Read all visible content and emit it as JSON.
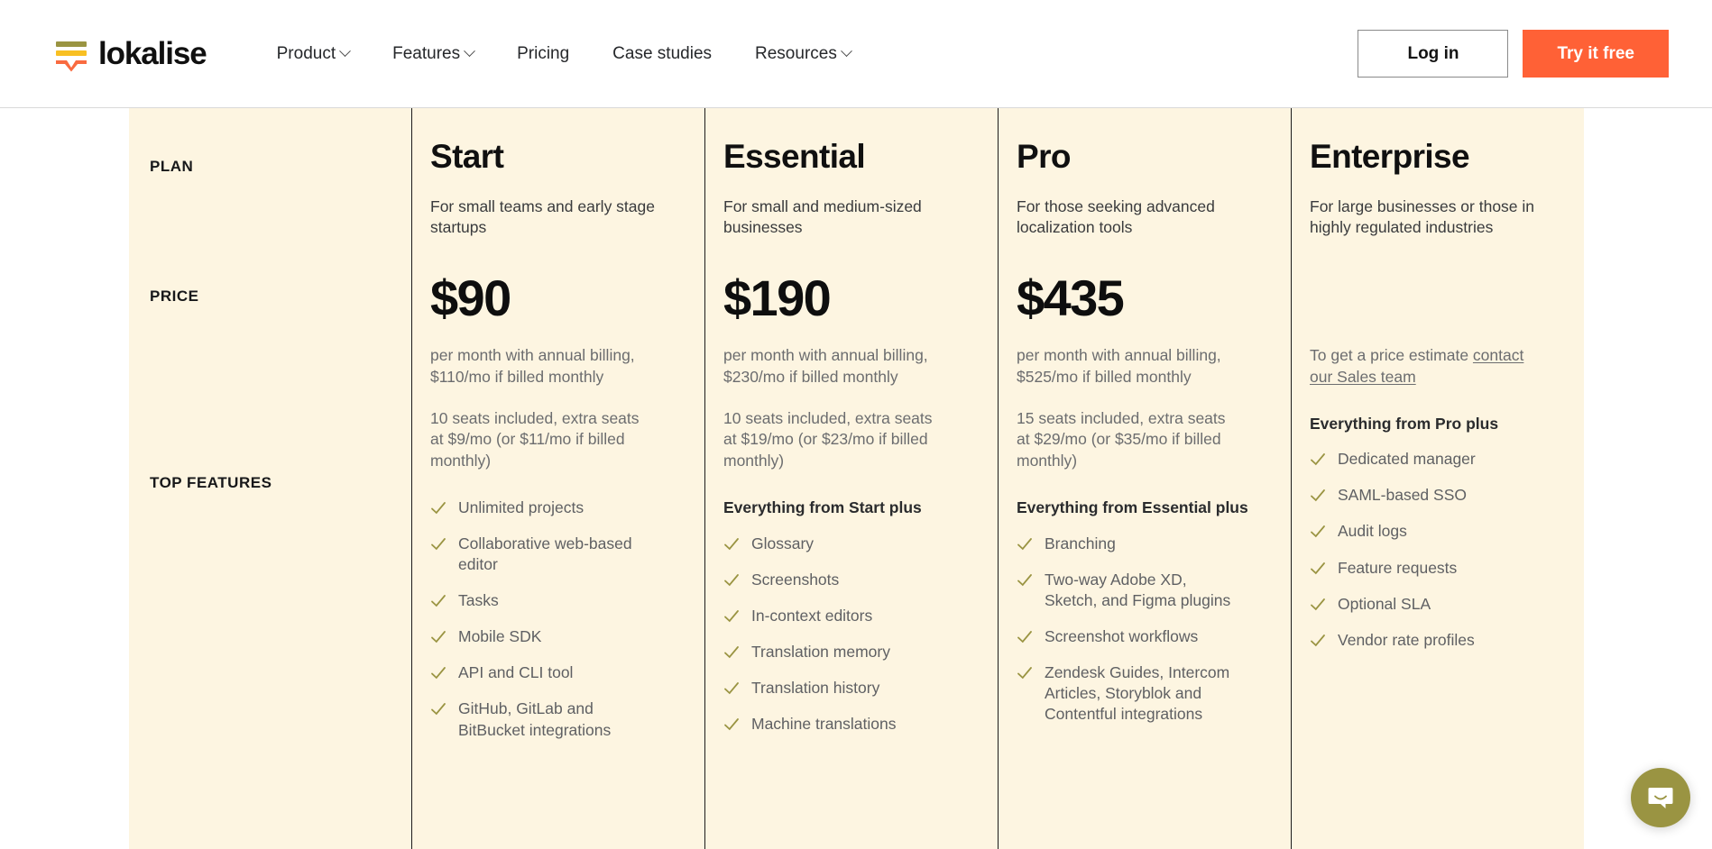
{
  "header": {
    "brand": "lokalise",
    "nav": [
      {
        "label": "Product",
        "has_dropdown": true
      },
      {
        "label": "Features",
        "has_dropdown": true
      },
      {
        "label": "Pricing",
        "has_dropdown": false
      },
      {
        "label": "Case studies",
        "has_dropdown": false
      },
      {
        "label": "Resources",
        "has_dropdown": true
      }
    ],
    "login_label": "Log in",
    "try_label": "Try it free"
  },
  "colors": {
    "accent_orange": "#ff6136",
    "panel_cream": "#fdf5e1",
    "check_olive": "#9a9442",
    "logo_olive": "#9a9442",
    "logo_yellow": "#f8c023",
    "logo_orange": "#f96b40"
  },
  "row_labels": {
    "plan": "PLAN",
    "price": "PRICE",
    "features": "TOP FEATURES"
  },
  "plans": [
    {
      "name": "Start",
      "desc": "For small teams and early stage startups",
      "price": "$90",
      "billing": "per month with annual billing, $110/mo if billed monthly",
      "seats": "10 seats included, extra seats at $9/mo (or $11/mo if billed monthly)",
      "features_heading": "",
      "features": [
        "Unlimited projects",
        "Collaborative web-based editor",
        "Tasks",
        "Mobile SDK",
        "API and CLI tool",
        "GitHub, GitLab and BitBucket integrations"
      ]
    },
    {
      "name": "Essential",
      "desc": "For small and medium-sized businesses",
      "price": "$190",
      "billing": "per month with annual billing, $230/mo if billed monthly",
      "seats": "10 seats included, extra seats at $19/mo (or $23/mo if billed monthly)",
      "features_heading": "Everything from Start plus",
      "features": [
        "Glossary",
        "Screenshots",
        "In-context editors",
        "Translation memory",
        "Translation history",
        "Machine translations"
      ]
    },
    {
      "name": "Pro",
      "desc": "For those seeking advanced localization tools",
      "price": "$435",
      "billing": "per month with annual billing, $525/mo if billed monthly",
      "seats": "15 seats included, extra seats at $29/mo (or $35/mo if billed monthly)",
      "features_heading": "Everything from Essential plus",
      "features": [
        "Branching",
        "Two-way Adobe XD, Sketch, and Figma plugins",
        "Screenshot workflows",
        "Zendesk Guides, Intercom Articles, Storyblok and Contentful integrations"
      ]
    },
    {
      "name": "Enterprise",
      "desc": "For large businesses or those in highly regulated industries",
      "price": "",
      "estimate_prefix": "To get a price estimate ",
      "estimate_link": "contact our Sales team",
      "features_heading": "Everything from Pro plus",
      "features": [
        "Dedicated manager",
        "SAML-based SSO",
        "Audit logs",
        "Feature requests",
        "Optional SLA",
        "Vendor rate profiles"
      ]
    }
  ],
  "chat": {
    "icon": "chat-bubble-icon"
  }
}
